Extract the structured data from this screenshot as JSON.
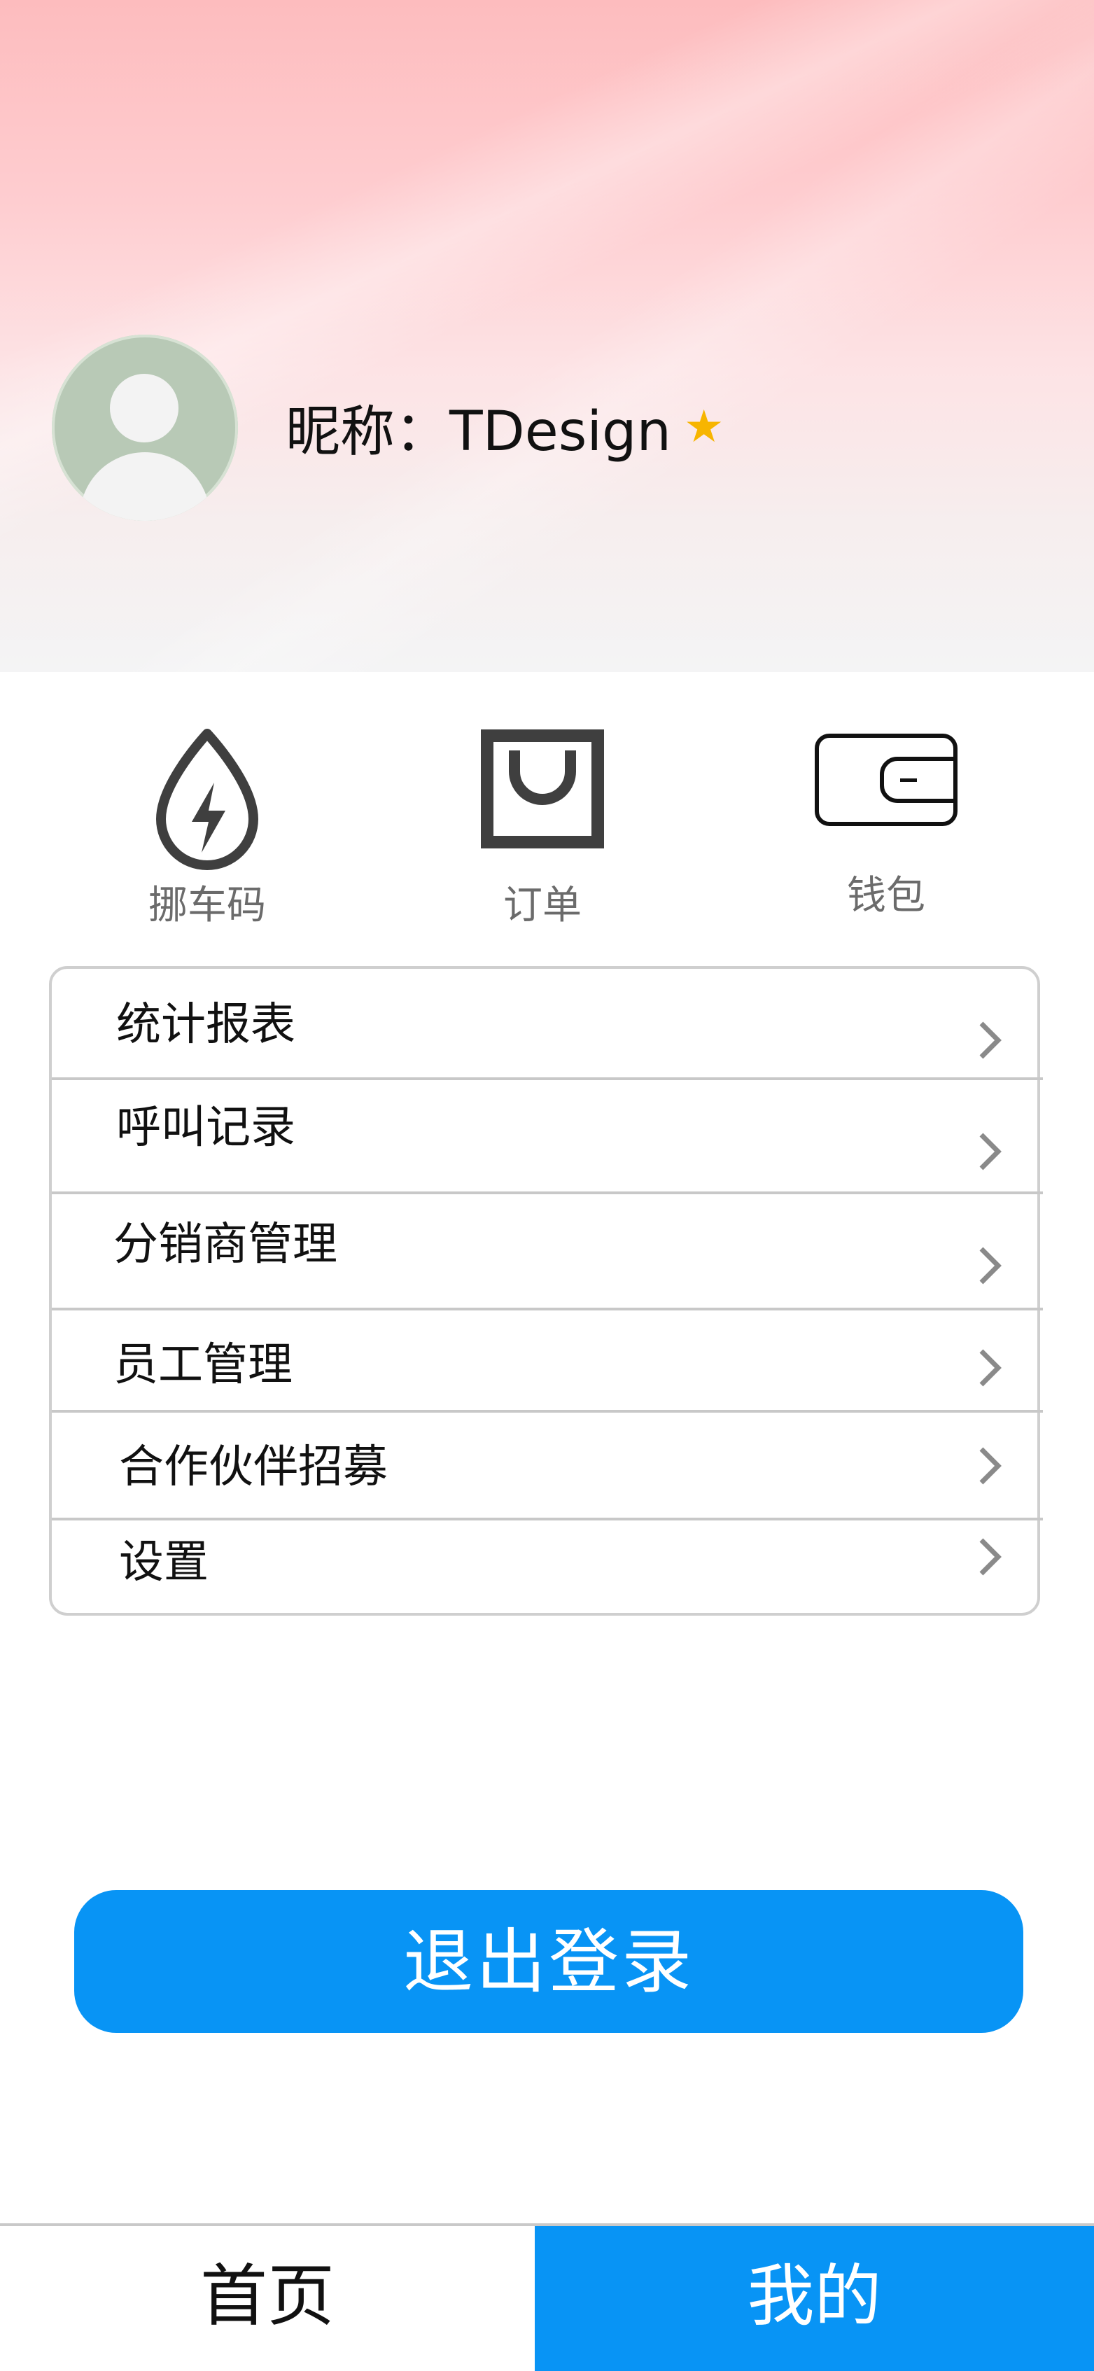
{
  "profile": {
    "nickname": "昵称：TDesign",
    "badge_icon": "star-badge-icon"
  },
  "shortcuts": [
    {
      "label": "挪车码",
      "icon": "drop-lightning-icon"
    },
    {
      "label": "订单",
      "icon": "shopping-bag-icon"
    },
    {
      "label": "钱包",
      "icon": "wallet-icon"
    }
  ],
  "menu": {
    "items": [
      {
        "label": "统计报表"
      },
      {
        "label": "呼叫记录"
      },
      {
        "label": "分销商管理"
      },
      {
        "label": "员工管理"
      },
      {
        "label": "合作伙伴招募"
      },
      {
        "label": "设置"
      }
    ]
  },
  "logout": {
    "label": "退出登录"
  },
  "tabbar": {
    "home": "首页",
    "mine": "我的",
    "active_color": "#0894f5"
  }
}
